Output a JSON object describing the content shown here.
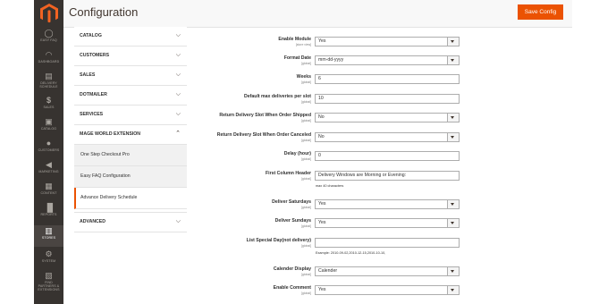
{
  "nav": [
    {
      "label": "EASY FAQ",
      "icon": "help-icon"
    },
    {
      "label": "DASHBOARD",
      "icon": "dashboard-icon"
    },
    {
      "label": "DELIVERY SCHEDULE",
      "icon": "delivery-icon"
    },
    {
      "label": "SALES",
      "icon": "dollar-icon"
    },
    {
      "label": "CATALOG",
      "icon": "box-icon"
    },
    {
      "label": "CUSTOMERS",
      "icon": "person-icon"
    },
    {
      "label": "MARKETING",
      "icon": "megaphone-icon"
    },
    {
      "label": "CONTENT",
      "icon": "layout-icon"
    },
    {
      "label": "REPORTS",
      "icon": "chart-icon"
    },
    {
      "label": "STORES",
      "icon": "store-icon"
    },
    {
      "label": "SYSTEM",
      "icon": "gear-icon"
    },
    {
      "label": "FIND PARTNERS & EXTENSIONS",
      "icon": "puzzle-icon"
    }
  ],
  "header": {
    "title": "Configuration",
    "save_label": "Save Config"
  },
  "tabs": [
    {
      "label": "CATALOG"
    },
    {
      "label": "CUSTOMERS"
    },
    {
      "label": "SALES"
    },
    {
      "label": "DOTMAILER"
    },
    {
      "label": "SERVICES"
    },
    {
      "label": "MAGE WORLD EXTENSION"
    }
  ],
  "subitems": [
    {
      "label": "One Step Checkout Pro"
    },
    {
      "label": "Easy FAQ Configuration"
    },
    {
      "label": "Advance Delivery Schedule"
    }
  ],
  "advanced_tab": {
    "label": "ADVANCED"
  },
  "form": [
    {
      "label": "Enable Module",
      "scope": "[store view]",
      "value": "Yes"
    },
    {
      "label": "Format Date",
      "scope": "[global]",
      "value": "mm-dd-yyyy"
    },
    {
      "label": "Weeks",
      "scope": "[global]",
      "value": "6"
    },
    {
      "label": "Default max deliveries per slot",
      "scope": "[global]",
      "value": "10"
    },
    {
      "label": "Return Delivery Slot When Order Shipped",
      "scope": "[global]",
      "value": "No"
    },
    {
      "label": "Return Delivery Slot When Order Canceled",
      "scope": "[global]",
      "value": "No"
    },
    {
      "label": "Delay (hour)",
      "scope": "[global]",
      "value": "0"
    },
    {
      "label": "First Column Header",
      "scope": "[global]",
      "value": "Delivery Windows are Morning or Evening:",
      "note": "max 40 characters"
    },
    {
      "label": "Deliver Saturdays",
      "scope": "[global]",
      "value": "Yes"
    },
    {
      "label": "Deliver Sundays",
      "scope": "[global]",
      "value": "Yes"
    },
    {
      "label": "List Special Day(not delivery)",
      "scope": "[global]",
      "value": "",
      "note": "Example: 2010-09-02,2010-12-15,2010-10-10,"
    },
    {
      "label": "Calender Display",
      "scope": "[global]",
      "value": "Calender"
    },
    {
      "label": "Enable Comment",
      "scope": "[global]",
      "value": "Yes"
    }
  ],
  "colors": {
    "accent": "#eb5202",
    "sidebar": "#373330"
  }
}
